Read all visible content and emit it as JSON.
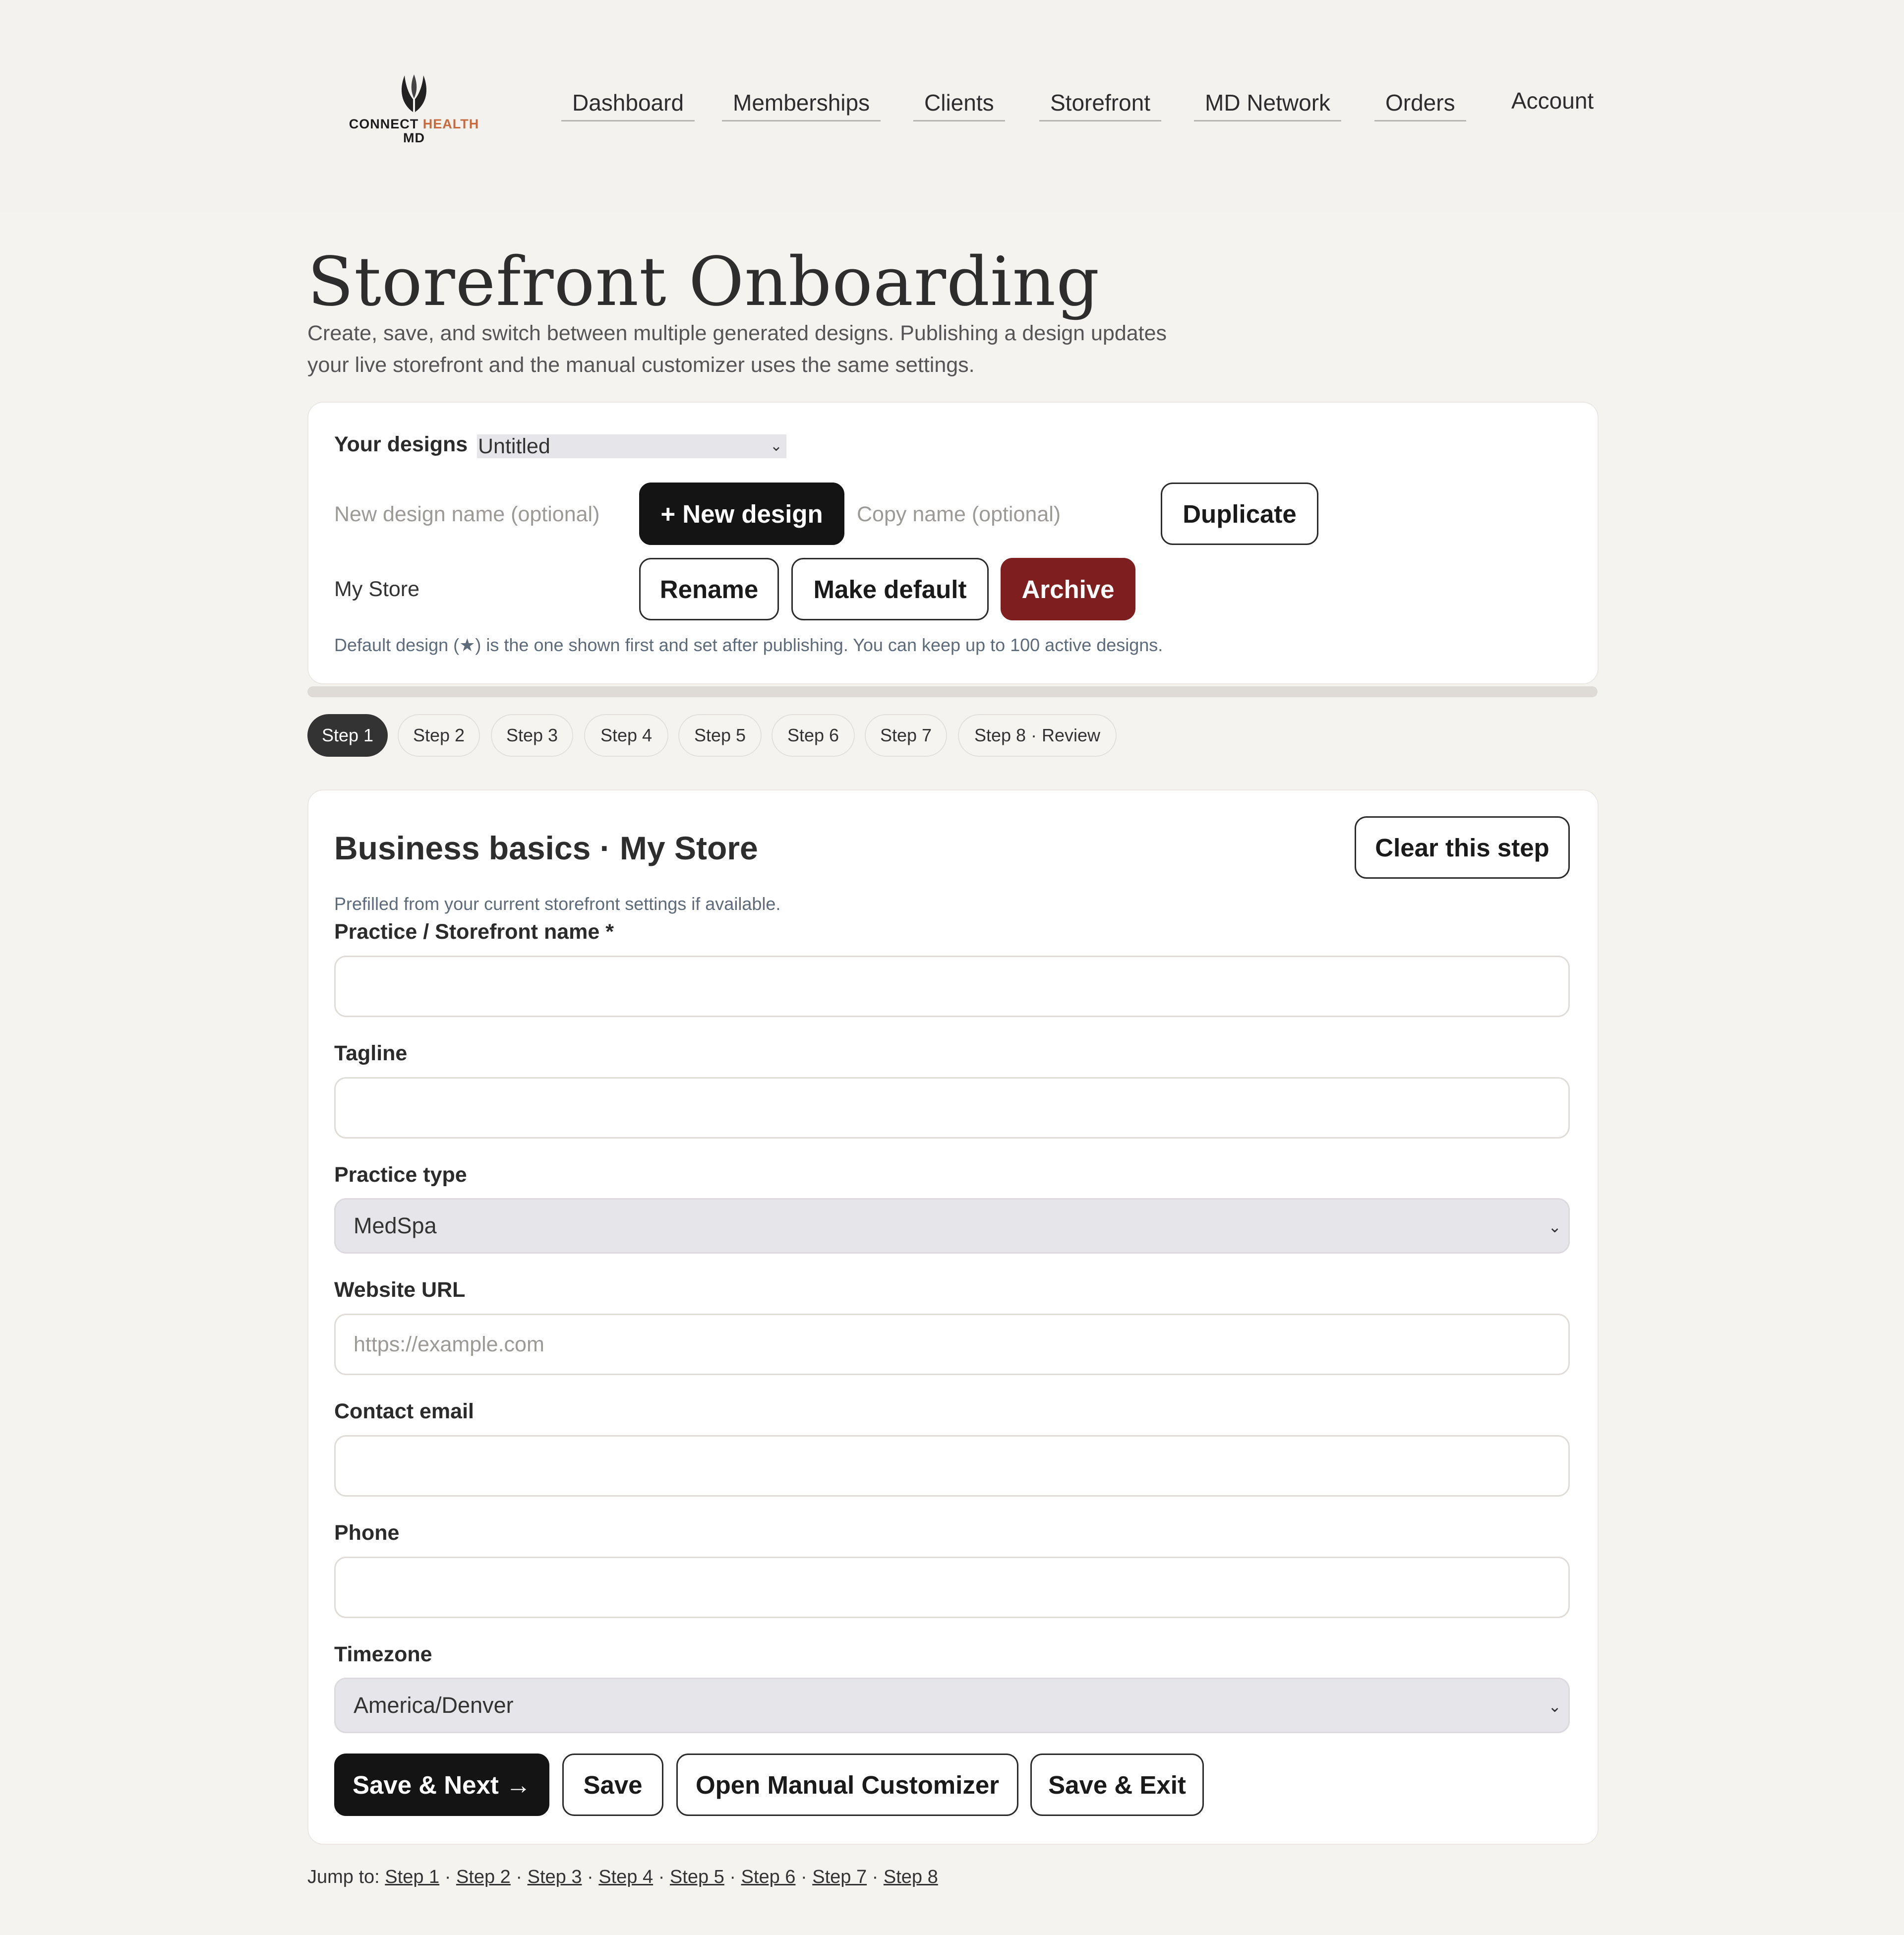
{
  "header": {
    "logo": {
      "line1_a": "CONNECT",
      "line1_b": "HEALTH",
      "line2": "MD"
    },
    "nav": [
      "Dashboard",
      "Memberships",
      "Clients",
      "Storefront",
      "MD Network",
      "Orders"
    ],
    "account": "Account"
  },
  "page": {
    "title": "Storefront Onboarding",
    "subtitle": "Create, save, and switch between multiple generated designs. Publishing a design updates your live storefront and the manual customizer uses the same settings."
  },
  "designs": {
    "label": "Your designs",
    "selected": "Untitled",
    "new_name_placeholder": "New design name (optional)",
    "new_button": "+ New design",
    "copy_name_placeholder": "Copy name (optional)",
    "duplicate_button": "Duplicate",
    "current_name": "My Store",
    "rename_button": "Rename",
    "make_default_button": "Make default",
    "archive_button": "Archive",
    "note": "Default design (★) is the one shown first and set after publishing. You can keep up to 100 active designs."
  },
  "steps": [
    "Step 1",
    "Step 2",
    "Step 3",
    "Step 4",
    "Step 5",
    "Step 6",
    "Step 7",
    "Step 8 · Review"
  ],
  "form": {
    "title": "Business basics · My Store",
    "clear_button": "Clear this step",
    "note": "Prefilled from your current storefront settings if available.",
    "name_label": "Practice / Storefront name *",
    "tagline_label": "Tagline",
    "practice_type_label": "Practice type",
    "practice_type_value": "MedSpa",
    "website_label": "Website URL",
    "website_placeholder": "https://example.com",
    "email_label": "Contact email",
    "phone_label": "Phone",
    "timezone_label": "Timezone",
    "timezone_value": "America/Denver",
    "buttons": {
      "save_next": "Save & Next →",
      "save": "Save",
      "open_customizer": "Open Manual Customizer",
      "save_exit": "Save & Exit"
    }
  },
  "jump": {
    "label": "Jump to:",
    "links": [
      "Step 1",
      "Step 2",
      "Step 3",
      "Step 4",
      "Step 5",
      "Step 6",
      "Step 7",
      "Step 8"
    ]
  }
}
